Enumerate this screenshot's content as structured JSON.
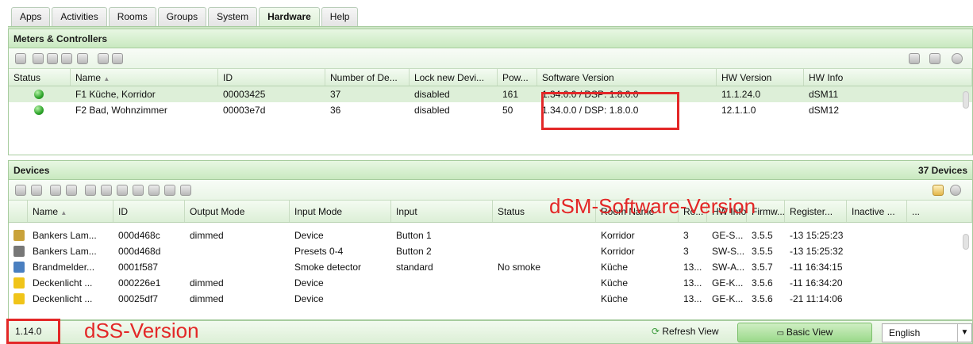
{
  "tabs": [
    {
      "label": "Apps"
    },
    {
      "label": "Activities"
    },
    {
      "label": "Rooms"
    },
    {
      "label": "Groups"
    },
    {
      "label": "System"
    },
    {
      "label": "Hardware"
    },
    {
      "label": "Help"
    }
  ],
  "meters": {
    "title": "Meters & Controllers",
    "columns": [
      "Status",
      "Name",
      "ID",
      "Number of De...",
      "Lock new Devi...",
      "Pow...",
      "Software Version",
      "HW Version",
      "HW Info"
    ],
    "sort_indicator": "▲",
    "rows": [
      {
        "name": "F1 Küche, Korridor",
        "id": "00003425",
        "devices": "37",
        "lock": "disabled",
        "power": "161",
        "sw": "1.34.0.0 / DSP: 1.8.0.0",
        "hw": "11.1.24.0",
        "info": "dSM11"
      },
      {
        "name": "F2 Bad, Wohnzimmer",
        "id": "00003e7d",
        "devices": "36",
        "lock": "disabled",
        "power": "50",
        "sw": "1.34.0.0 / DSP: 1.8.0.0",
        "hw": "12.1.1.0",
        "info": "dSM12"
      }
    ]
  },
  "devices": {
    "title": "Devices",
    "count": "37 Devices",
    "columns": [
      "Name",
      "ID",
      "Output Mode",
      "Input Mode",
      "Input",
      "Status",
      "Room Name",
      "Ro...",
      "HW Info",
      "Firmw...",
      "Register...",
      "Inactive ...",
      "..."
    ],
    "rows": [
      {
        "name": "Bankers Lam...",
        "id": "000d468c",
        "output": "dimmed",
        "inmode": "Device",
        "input": "Button 1",
        "status": "",
        "room": "Korridor",
        "ro": "3",
        "hw": "GE-S...",
        "fw": "3.5.5",
        "reg": "-13 15:25:23",
        "icon": "#c9a23a"
      },
      {
        "name": "Bankers Lam...",
        "id": "000d468d",
        "output": "",
        "inmode": "Presets 0-4",
        "input": "Button 2",
        "status": "",
        "room": "Korridor",
        "ro": "3",
        "hw": "SW-S...",
        "fw": "3.5.5",
        "reg": "-13 15:25:32",
        "icon": "#777777"
      },
      {
        "name": "Brandmelder...",
        "id": "0001f587",
        "output": "",
        "inmode": "Smoke detector",
        "input": "standard",
        "status": "No smoke",
        "room": "Küche",
        "ro": "13...",
        "hw": "SW-A...",
        "fw": "3.5.7",
        "reg": "-11 16:34:15",
        "icon": "#4a7fc0"
      },
      {
        "name": "Deckenlicht ...",
        "id": "000226e1",
        "output": "dimmed",
        "inmode": "Device",
        "input": "",
        "status": "",
        "room": "Küche",
        "ro": "13...",
        "hw": "GE-K...",
        "fw": "3.5.6",
        "reg": "-11 16:34:20",
        "icon": "#f0c419"
      },
      {
        "name": "Deckenlicht ...",
        "id": "00025df7",
        "output": "dimmed",
        "inmode": "Device",
        "input": "",
        "status": "",
        "room": "Küche",
        "ro": "13...",
        "hw": "GE-K...",
        "fw": "3.5.6",
        "reg": "-21 11:14:06",
        "icon": "#f0c419"
      }
    ]
  },
  "footer": {
    "version": "1.14.0",
    "refresh_label": "Refresh View",
    "basic_label": "Basic View",
    "language": "English"
  },
  "annotations": {
    "dsm": "dSM-Software-Version",
    "dss": "dSS-Version",
    "color": "#e32727"
  }
}
